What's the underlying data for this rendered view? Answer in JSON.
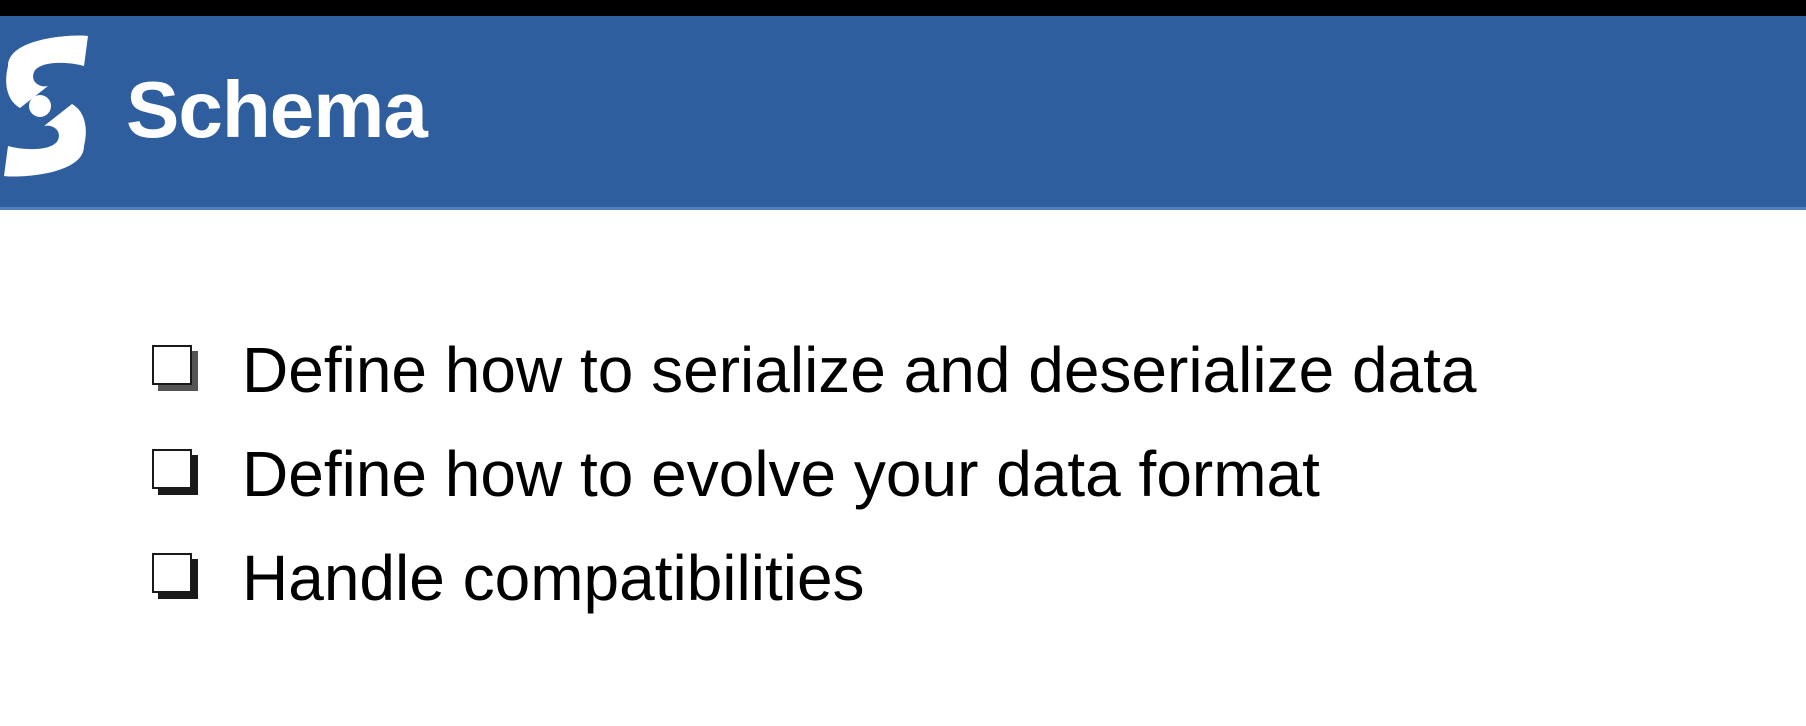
{
  "header": {
    "title": "Schema",
    "logo_icon": "schema-s-logo-icon",
    "background_color": "#2e5e9e",
    "title_color": "#ffffff"
  },
  "bullets": {
    "icon": "checkbox-icon",
    "items": [
      {
        "text": "Define how to serialize and deserialize data"
      },
      {
        "text": "Define how to evolve your data format"
      },
      {
        "text": "Handle compatibilities"
      }
    ]
  }
}
